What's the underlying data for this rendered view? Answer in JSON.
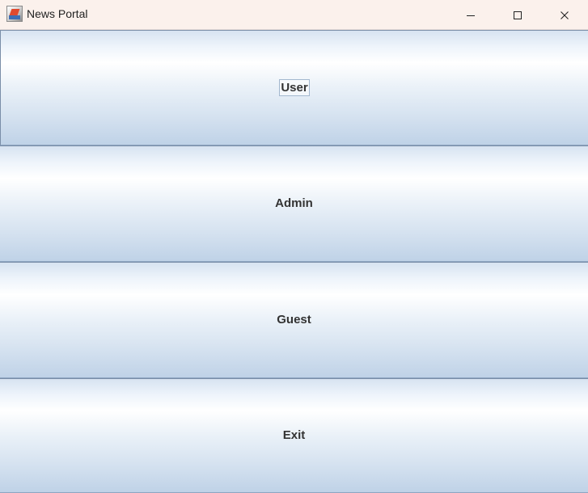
{
  "window": {
    "title": "News Portal",
    "icon": "java-app-icon",
    "controls": {
      "minimize": "minimize-icon",
      "maximize": "maximize-icon",
      "close": "close-icon"
    }
  },
  "menu": {
    "buttons": [
      {
        "label": "User"
      },
      {
        "label": "Admin"
      },
      {
        "label": "Guest"
      },
      {
        "label": "Exit"
      }
    ]
  },
  "colors": {
    "titlebar": "#fbf1ec",
    "button_top": "#d7e3f1",
    "button_mid": "#ffffff",
    "button_bottom": "#bfd2e7",
    "button_border": "#7a8ea8",
    "text": "#333333"
  }
}
